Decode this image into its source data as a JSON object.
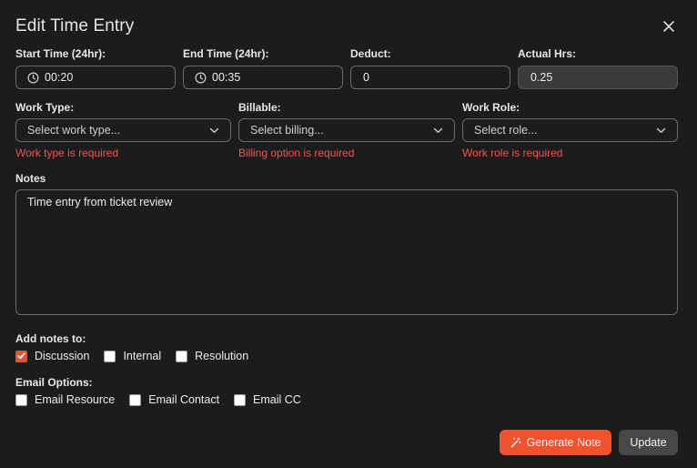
{
  "dialog": {
    "title": "Edit Time Entry"
  },
  "fields": {
    "start_time": {
      "label": "Start Time (24hr):",
      "value": "00:20"
    },
    "end_time": {
      "label": "End Time (24hr):",
      "value": "00:35"
    },
    "deduct": {
      "label": "Deduct:",
      "value": "0"
    },
    "actual_hrs": {
      "label": "Actual Hrs:",
      "value": "0.25"
    }
  },
  "selects": {
    "work_type": {
      "label": "Work Type:",
      "placeholder": "Select work type...",
      "error": "Work type is required"
    },
    "billable": {
      "label": "Billable:",
      "placeholder": "Select billing...",
      "error": "Billing option is required"
    },
    "work_role": {
      "label": "Work Role:",
      "placeholder": "Select role...",
      "error": "Work role is required"
    }
  },
  "notes": {
    "label": "Notes",
    "value": "Time entry from ticket review"
  },
  "add_notes_to": {
    "label": "Add notes to:",
    "options": [
      {
        "label": "Discussion",
        "checked": true
      },
      {
        "label": "Internal",
        "checked": false
      },
      {
        "label": "Resolution",
        "checked": false
      }
    ]
  },
  "email_options": {
    "label": "Email Options:",
    "options": [
      {
        "label": "Email Resource",
        "checked": false
      },
      {
        "label": "Email Contact",
        "checked": false
      },
      {
        "label": "Email CC",
        "checked": false
      }
    ]
  },
  "buttons": {
    "generate_note": "Generate Note",
    "update": "Update"
  },
  "colors": {
    "background": "#1c1c1c",
    "accent": "#f0512f",
    "error": "#f0544b",
    "secondary_button": "#474747"
  },
  "icons": {
    "close": "close-icon",
    "clock": "clock-icon",
    "chevron": "chevron-down-icon",
    "wand": "magic-wand-icon",
    "check": "checkmark-icon"
  }
}
